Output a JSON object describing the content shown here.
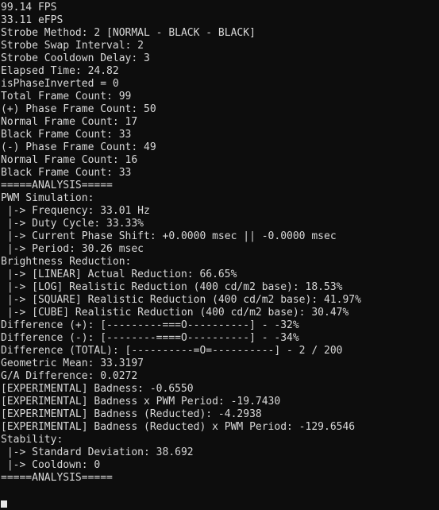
{
  "terminal": {
    "background_color": "#0d0d0d",
    "text_color": "#d8d8d8",
    "cursor_color": "#e8e8e8"
  },
  "lines": [
    {
      "text": "99.14 FPS"
    },
    {
      "text": "33.11 eFPS"
    },
    {
      "text": "Strobe Method: 2 [NORMAL - BLACK - BLACK]"
    },
    {
      "text": "Strobe Swap Interval: 2"
    },
    {
      "text": "Strobe Cooldown Delay: 3"
    },
    {
      "text": "Elapsed Time: 24.82"
    },
    {
      "text": "isPhaseInverted = 0"
    },
    {
      "text": "Total Frame Count: 99"
    },
    {
      "text": "(+) Phase Frame Count: 50"
    },
    {
      "text": "Normal Frame Count: 17"
    },
    {
      "text": "Black Frame Count: 33"
    },
    {
      "text": "(-) Phase Frame Count: 49"
    },
    {
      "text": "Normal Frame Count: 16"
    },
    {
      "text": "Black Frame Count: 33"
    },
    {
      "text": "=====ANALYSIS====="
    },
    {
      "text": "PWM Simulation:"
    },
    {
      "text": " |-> Frequency: 33.01 Hz"
    },
    {
      "text": " |-> Duty Cycle: 33.33%"
    },
    {
      "text": " |-> Current Phase Shift: +0.0000 msec || -0.0000 msec"
    },
    {
      "text": " |-> Period: 30.26 msec"
    },
    {
      "text": "Brightness Reduction:"
    },
    {
      "text": " |-> [LINEAR] Actual Reduction: 66.65%"
    },
    {
      "text": " |-> [LOG] Realistic Reduction (400 cd/m2 base): 18.53%"
    },
    {
      "text": " |-> [SQUARE] Realistic Reduction (400 cd/m2 base): 41.97%"
    },
    {
      "text": " |-> [CUBE] Realistic Reduction (400 cd/m2 base): 30.47%"
    },
    {
      "text": "Difference (+): [---------===O----------] - -32%"
    },
    {
      "text": "Difference (-): [--------====O----------] - -34%"
    },
    {
      "text": "Difference (TOTAL): [----------=O=----------] - 2 / 200"
    },
    {
      "text": "Geometric Mean: 33.3197"
    },
    {
      "text": "G/A Difference: 0.0272"
    },
    {
      "text": "[EXPERIMENTAL] Badness: -0.6550"
    },
    {
      "text": "[EXPERIMENTAL] Badness x PWM Period: -19.7430"
    },
    {
      "text": "[EXPERIMENTAL] Badness (Reducted): -4.2938"
    },
    {
      "text": "[EXPERIMENTAL] Badness (Reducted) x PWM Period: -129.6546"
    },
    {
      "text": "Stability:"
    },
    {
      "text": " |-> Standard Deviation: 38.692"
    },
    {
      "text": " |-> Cooldown: 0"
    },
    {
      "text": "=====ANALYSIS====="
    },
    {
      "text": ""
    }
  ],
  "cursor": {
    "name": "text-cursor",
    "visible": true
  },
  "metrics": {
    "fps": "99.14",
    "efps": "33.11",
    "strobe_method": "2",
    "strobe_method_label": "NORMAL - BLACK - BLACK",
    "strobe_swap_interval": "2",
    "strobe_cooldown_delay": "3",
    "elapsed_time": "24.82",
    "is_phase_inverted": "0",
    "total_frame_count": "99",
    "plus_phase_frame_count": "50",
    "plus_normal_frame_count": "17",
    "plus_black_frame_count": "33",
    "minus_phase_frame_count": "49",
    "minus_normal_frame_count": "16",
    "minus_black_frame_count": "33",
    "pwm_frequency": "33.01 Hz",
    "pwm_duty_cycle": "33.33%",
    "pwm_phase_shift_positive": "+0.0000 msec",
    "pwm_phase_shift_negative": "-0.0000 msec",
    "pwm_period": "30.26 msec",
    "reduction_linear": "66.65%",
    "reduction_log": "18.53%",
    "reduction_square": "41.97%",
    "reduction_cube": "30.47%",
    "difference_plus": "-32%",
    "difference_minus": "-34%",
    "difference_total": "2 / 200",
    "geometric_mean": "33.3197",
    "ga_difference": "0.0272",
    "badness": "-0.6550",
    "badness_x_pwm_period": "-19.7430",
    "badness_reducted": "-4.2938",
    "badness_reducted_x_pwm_period": "-129.6546",
    "standard_deviation": "38.692",
    "cooldown": "0"
  }
}
